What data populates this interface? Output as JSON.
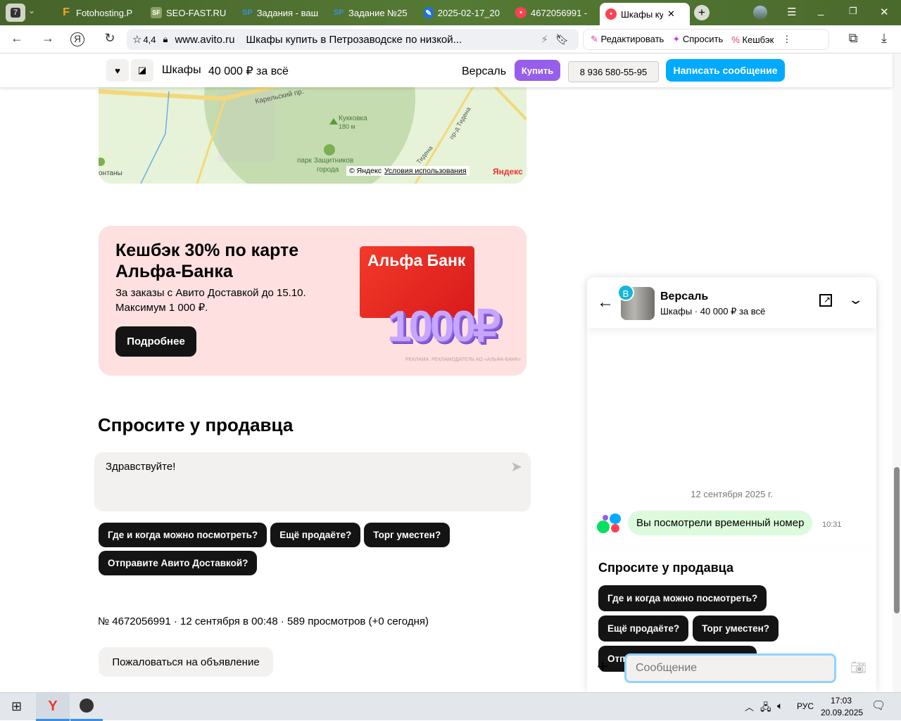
{
  "browser": {
    "tab_count": "7",
    "tabs": [
      {
        "label": "Fotohosting.P",
        "icon": "F",
        "color": "#f5a623"
      },
      {
        "label": "SEO-FAST.RU",
        "icon": "SF",
        "color": "#8aa060"
      },
      {
        "label": "Задания - ваш",
        "icon": "SP",
        "color": "#3b8fd9"
      },
      {
        "label": "Задание №25",
        "icon": "SP",
        "color": "#3b8fd9"
      },
      {
        "label": "2025-02-17_20",
        "icon": "pen",
        "color": "#1a73e8"
      },
      {
        "label": "4672056991 -",
        "icon": "avito",
        "color": "#ff4053"
      },
      {
        "label": "Шкафы куп",
        "icon": "avito",
        "color": "#ff4053"
      }
    ],
    "rating": "4,4",
    "domain": "www.avito.ru",
    "page_title": "Шкафы купить в Петрозаводске по низкой...",
    "ext": {
      "edit": "Редактировать",
      "ask": "Спросить",
      "cashback": "Кешбэк"
    }
  },
  "sticky": {
    "title": "Шкафы",
    "price": "40 000 ₽ за всё",
    "seller": "Версаль",
    "buy": "Купить",
    "phone": "8 936 580-55-95",
    "write": "Написать сообщение"
  },
  "map": {
    "labels": {
      "road": "Карельский пр.",
      "hill": "Кукковка",
      "hill_height": "180 м",
      "park": "парк Защитников",
      "park2": "города",
      "fontany": "онтаны",
      "tideна1": "пр-д Тидена",
      "tidena2": "Тидена"
    },
    "copyright": "© Яндекс",
    "terms": "Условия использования",
    "logo": "Яндекс"
  },
  "ad": {
    "title": "Кешбэк 30% по карте Альфа-Банка",
    "text1": "За заказы с Авито Доставкой до 15.10.",
    "text2": "Максимум 1 000 ₽.",
    "button": "Подробнее",
    "card_brand": "Альфа Банк",
    "amount": "1000₽",
    "disclaimer": "РЕКЛАМА. РЕКЛАМОДАТЕЛЬ АО «АЛЬФА-БАНК»"
  },
  "ask": {
    "heading": "Спросите у продавца",
    "message": "Здравствуйте!",
    "chips": [
      "Где и когда можно посмотреть?",
      "Ещё продаёте?",
      "Торг уместен?",
      "Отправите Авито Доставкой?"
    ]
  },
  "info": "№ 4672056991 · 12 сентября в 00:48 · 589 просмотров (+0 сегодня)",
  "report": "Пожаловаться на объявление",
  "chat": {
    "badge": "В",
    "name": "Версаль",
    "subtitle": "Шкафы · 40 000 ₽ за всё",
    "date": "12 сентября 2025 г.",
    "message": "Вы посмотрели временный номер",
    "time": "10:31",
    "ask_heading": "Спросите у продавца",
    "chips": [
      "Где и когда можно посмотреть?",
      "Ещё продаёте?",
      "Торг уместен?",
      "Отправите Авито Доставкой?"
    ],
    "placeholder": "Сообщение"
  },
  "taskbar": {
    "lang": "РУС",
    "time": "17:03",
    "date": "20.09.2025"
  }
}
